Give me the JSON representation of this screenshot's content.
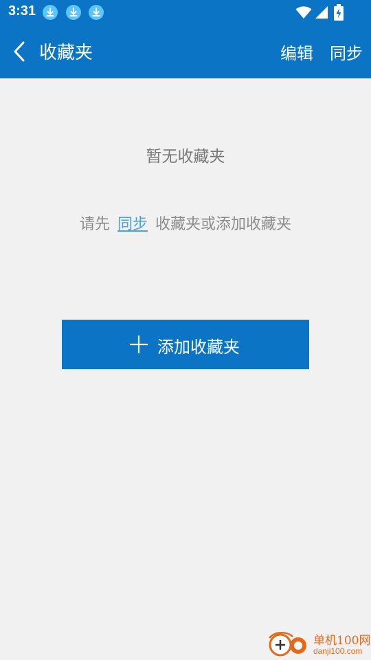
{
  "status_bar": {
    "time": "3:31",
    "notification_icons": [
      "download-icon",
      "download-icon",
      "download-icon"
    ],
    "right_icons": [
      "wifi-icon",
      "signal-icon",
      "battery-charging-icon"
    ]
  },
  "nav": {
    "title": "收藏夹",
    "edit_label": "编辑",
    "sync_label": "同步"
  },
  "empty_state": {
    "title": "暂无收藏夹",
    "hint_prefix": "请先",
    "hint_link": "同步",
    "hint_suffix": "收藏夹或添加收藏夹"
  },
  "add_button": {
    "label": "添加收藏夹"
  },
  "watermark": {
    "name": "单机100网",
    "url": "danji100.com"
  },
  "colors": {
    "primary": "#0b74c4",
    "background": "#f1f1f1",
    "link": "#4aa3e8",
    "watermark": "#e36a1a"
  }
}
